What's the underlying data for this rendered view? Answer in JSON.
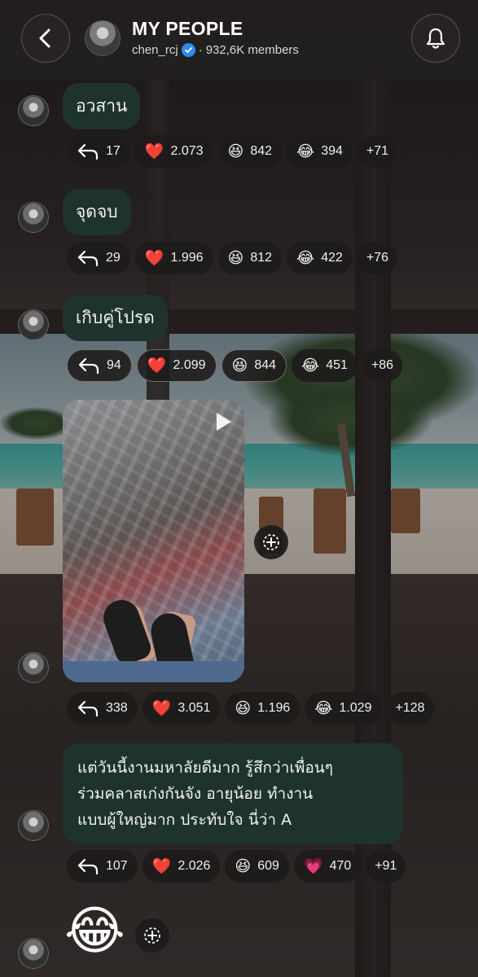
{
  "header": {
    "title": "MY PEOPLE",
    "handle": "chen_rcj",
    "members": "932,6K members"
  },
  "messages": [
    {
      "text": "อวสาน",
      "reactions": {
        "reply": "17",
        "heart": "2.073",
        "grin": "842",
        "joy": "394",
        "more": "+71"
      }
    },
    {
      "text": "จุดจบ",
      "reactions": {
        "reply": "29",
        "heart": "1.996",
        "grin": "812",
        "joy": "422",
        "more": "+76"
      }
    },
    {
      "text": "เกิบคู่โปรด",
      "reactions": {
        "reply": "94",
        "heart": "2.099",
        "grin": "844",
        "joy": "451",
        "more": "+86"
      }
    },
    {
      "text": "",
      "reactions": {
        "reply": "338",
        "heart": "3.051",
        "grin": "1.196",
        "joy": "1.029",
        "more": "+128"
      }
    },
    {
      "text": "แต่วันนี้งานมหาลัยดีมาก รู้สึกว่าเพื่อนๆ ร่วมคลาสเก่งกันจัง อายุน้อย ทำงานแบบผู้ใหญ่มาก ประทับใจ นี่ว่า A",
      "text_lines": [
        "แต่วันนี้งานมหาลัยดีมาก รู้สึกว่าเพื่อนๆ",
        "ร่วมคลาสเก่งกันจัง อายุน้อย ทำงาน",
        "แบบผู้ใหญ่มาก ประทับใจ นี่ว่า A"
      ],
      "reactions": {
        "reply": "107",
        "heart": "2.026",
        "grin": "609",
        "sparkle_heart": "470",
        "more": "+91"
      }
    },
    {
      "emoji": "😂"
    }
  ],
  "emojis": {
    "heart": "❤️",
    "grin": "😆",
    "joy": "😂",
    "sparkle_heart": "💗"
  },
  "icons": [
    "back-arrow-icon",
    "bell-icon",
    "verified-badge-icon",
    "reply-icon",
    "play-icon",
    "add-reaction-icon"
  ],
  "colors": {
    "bubble": "#1e332d",
    "chip": "#1c1a1a",
    "verified": "#2f8cf0"
  }
}
